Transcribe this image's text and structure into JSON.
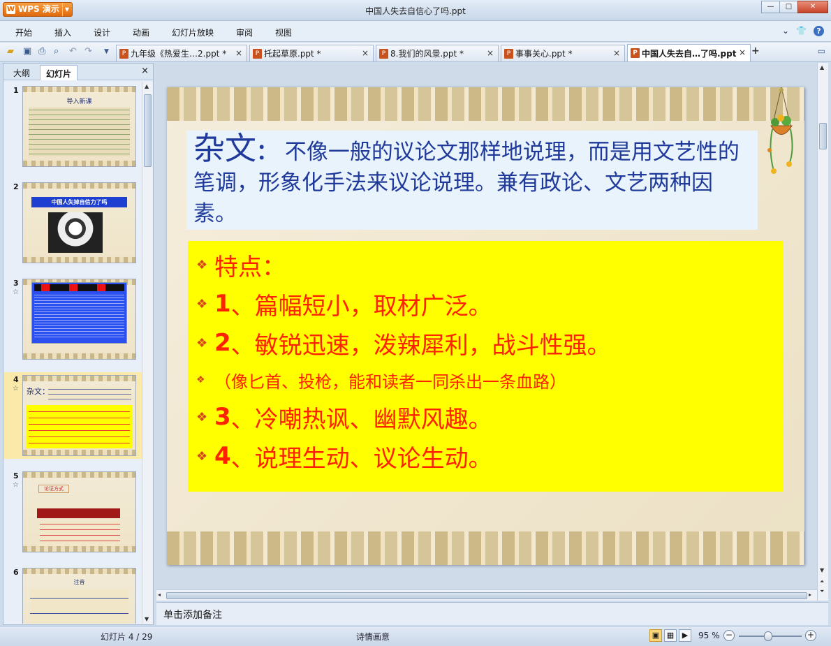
{
  "app": {
    "name": "WPS 演示",
    "window_title": "中国人失去自信心了吗.ppt"
  },
  "window_controls": {
    "minimize": "—",
    "maximize": "□",
    "close": "✕"
  },
  "menu": [
    "开始",
    "插入",
    "设计",
    "动画",
    "幻灯片放映",
    "审阅",
    "视图"
  ],
  "menu_right": {
    "collapse": "⌄",
    "skin": "👕",
    "help": "?"
  },
  "tabs": [
    {
      "label": "九年级《热爱生…2.ppt *",
      "active": false
    },
    {
      "label": "托起草原.ppt *",
      "active": false
    },
    {
      "label": "8.我们的风景.ppt *",
      "active": false
    },
    {
      "label": "事事关心.ppt *",
      "active": false
    },
    {
      "label": "中国人失去自…了吗.ppt",
      "active": true
    }
  ],
  "tab_close": "×",
  "new_tab": "+",
  "left_pane": {
    "tabs": [
      "大纲",
      "幻灯片"
    ],
    "active_tab": "幻灯片",
    "close": "×",
    "thumbnails": [
      {
        "num": "1",
        "title": "导入新课",
        "star": ""
      },
      {
        "num": "2",
        "title": "中国人失掉自信力了吗",
        "star": ""
      },
      {
        "num": "3",
        "title": "",
        "star": "☆"
      },
      {
        "num": "4",
        "title": "杂文：",
        "star": "☆",
        "selected": true
      },
      {
        "num": "5",
        "title": "论证方式",
        "star": "☆"
      },
      {
        "num": "6",
        "title": "注音",
        "star": ""
      }
    ]
  },
  "slide": {
    "definition_keyword": "杂文",
    "definition_colon": "：",
    "definition_text": "不像一般的议论文那样地说理，而是用文艺性的笔调，形象化手法来议论说理。兼有政论、文艺两种因素。",
    "bullet": "❖",
    "features": [
      {
        "num": "",
        "text": "特点：",
        "size": "big"
      },
      {
        "num": "1",
        "text": "、篇幅短小，取材广泛。",
        "size": "big"
      },
      {
        "num": "2",
        "text": "、敏锐迅速，泼辣犀利，战斗性强。",
        "size": "big"
      },
      {
        "num": "",
        "text": "（像匕首、投枪，能和读者一同杀出一条血路）",
        "size": "small"
      },
      {
        "num": "3",
        "text": "、冷嘲热讽、幽默风趣。",
        "size": "big"
      },
      {
        "num": "4",
        "text": "、说理生动、议论生动。",
        "size": "big"
      }
    ]
  },
  "notes_placeholder": "单击添加备注",
  "status": {
    "slide_counter": "幻灯片 4 / 29",
    "theme": "诗情画意",
    "zoom": "95 %",
    "zoom_level": 0.95
  }
}
